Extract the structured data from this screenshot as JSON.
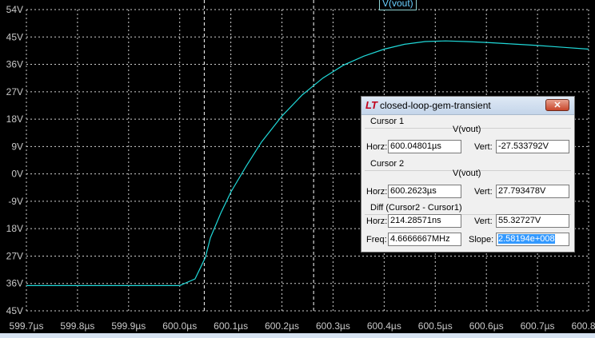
{
  "trace_label": "V(vout)",
  "colors": {
    "trace": "#20d8d8",
    "grid": "#d0d0d0",
    "background": "#000000"
  },
  "chart_data": {
    "type": "line",
    "xlabel": "",
    "ylabel": "",
    "ylim": [
      -45,
      54
    ],
    "xlim": [
      599.7,
      600.8
    ],
    "grid": true,
    "y_ticks": [
      "54V",
      "45V",
      "36V",
      "27V",
      "18V",
      "9V",
      "0V",
      "-9V",
      "18V",
      "27V",
      "36V",
      "45V"
    ],
    "x_ticks": [
      "599.7µs",
      "599.8µs",
      "599.9µs",
      "600.0µs",
      "600.1µs",
      "600.2µs",
      "600.3µs",
      "600.4µs",
      "600.5µs",
      "600.6µs",
      "600.7µs",
      "600.8µs"
    ],
    "series": [
      {
        "x": [
          599.7,
          599.8,
          599.9,
          600.0,
          600.03,
          600.05,
          600.06,
          600.08,
          600.1,
          600.13,
          600.16,
          600.2,
          600.24,
          600.28,
          600.32,
          600.36,
          600.4,
          600.44,
          600.48,
          600.52,
          600.56,
          600.6,
          600.65,
          600.7,
          600.75,
          600.8
        ],
        "y": [
          -36.7,
          -36.7,
          -36.7,
          -36.7,
          -34.5,
          -27.5,
          -21,
          -13,
          -6,
          2.5,
          10.5,
          19,
          26,
          31.5,
          35.7,
          38.7,
          41,
          42.6,
          43.5,
          43.7,
          43.5,
          43.2,
          42.7,
          42.2,
          41.6,
          41.0
        ]
      }
    ],
    "cursors": [
      600.048,
      600.262
    ]
  },
  "dialog": {
    "title": "closed-loop-gem-transient",
    "close": "✕",
    "cursor1": {
      "label": "Cursor 1",
      "signal": "V(vout)",
      "horz_label": "Horz:",
      "horz": "600.04801µs",
      "vert_label": "Vert:",
      "vert": "-27.533792V"
    },
    "cursor2": {
      "label": "Cursor 2",
      "signal": "V(vout)",
      "horz_label": "Horz:",
      "horz": "600.2623µs",
      "vert_label": "Vert:",
      "vert": "27.793478V"
    },
    "diff": {
      "label": "Diff (Cursor2 - Cursor1)",
      "horz_label": "Horz:",
      "horz": "214.28571ns",
      "vert_label": "Vert:",
      "vert": "55.32727V",
      "freq_label": "Freq:",
      "freq": "4.6666667MHz",
      "slope_label": "Slope:",
      "slope": "2.58194e+008"
    }
  }
}
